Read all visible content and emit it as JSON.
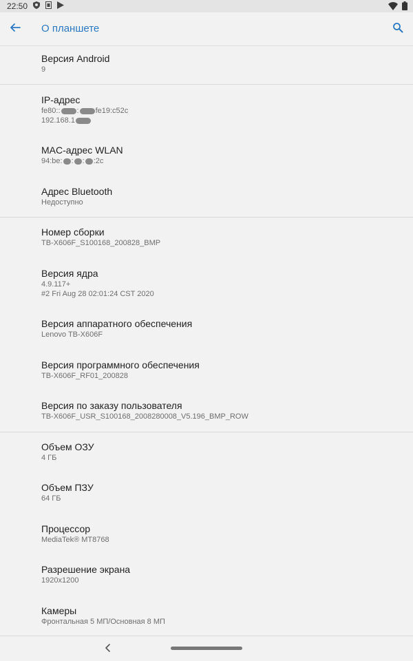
{
  "status_bar": {
    "time": "22:50",
    "icons_left": [
      "shield-icon",
      "sim-icon",
      "play-store-icon"
    ],
    "icons_right": [
      "wifi-icon",
      "battery-icon"
    ]
  },
  "app_bar": {
    "title": "О планшете",
    "back_icon": "arrow-back-icon",
    "search_icon": "search-icon",
    "accent_color": "#2a79c4"
  },
  "items": [
    {
      "title": "Версия Android",
      "subtitle": "9"
    },
    {
      "title": "IP-адрес",
      "subtitle_line1_a": "fe80::",
      "subtitle_line1_b": "fe19:c52c",
      "subtitle_line2_a": "192.168.1"
    },
    {
      "title": "MAC-адрес WLAN",
      "subtitle_a": "94:be:",
      "subtitle_b": ":2c"
    },
    {
      "title": "Адрес Bluetooth",
      "subtitle": "Недоступно"
    },
    {
      "title": "Номер сборки",
      "subtitle": "TB-X606F_S100168_200828_BMP"
    },
    {
      "title": "Версия ядра",
      "subtitle_line1": "4.9.117+",
      "subtitle_line2": "#2 Fri Aug 28 02:01:24 CST 2020"
    },
    {
      "title": "Версия аппаратного обеспечения",
      "subtitle": "Lenovo TB-X606F"
    },
    {
      "title": "Версия программного обеспечения",
      "subtitle": "TB-X606F_RF01_200828"
    },
    {
      "title": "Версия по заказу пользователя",
      "subtitle": "TB-X606F_USR_S100168_2008280008_V5.196_BMP_ROW"
    },
    {
      "title": "Объем ОЗУ",
      "subtitle": "4 ГБ"
    },
    {
      "title": "Объем ПЗУ",
      "subtitle": "64 ГБ"
    },
    {
      "title": "Процессор",
      "subtitle": "MediaTek® MT8768"
    },
    {
      "title": "Разрешение экрана",
      "subtitle": "1920x1200"
    },
    {
      "title": "Камеры",
      "subtitle": "Фронтальная 5 МП/Основная 8 МП"
    }
  ],
  "nav_bar": {
    "back_icon": "nav-back-icon",
    "home_icon": "home-pill-icon"
  }
}
